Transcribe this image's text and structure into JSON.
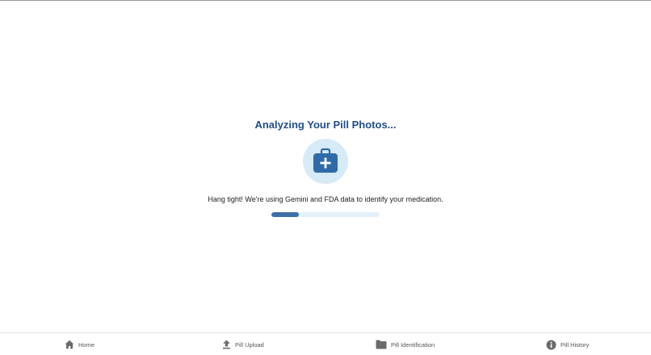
{
  "main": {
    "title": "Analyzing Your Pill Photos...",
    "icon": "medical-kit-icon",
    "message": "Hang tight! We're using Gemini and FDA data to identify your medication.",
    "progress": 0.25
  },
  "nav": {
    "items": [
      {
        "label": "Home",
        "icon": "home-icon"
      },
      {
        "label": "Pill Upload",
        "icon": "upload-icon"
      },
      {
        "label": "Pill Identification",
        "icon": "folder-icon"
      },
      {
        "label": "Pill History",
        "icon": "info-icon"
      }
    ]
  },
  "colors": {
    "title": "#1f4e8c",
    "accent": "#2f6ba8",
    "icon_bg": "#d6eaf8",
    "progress_track": "#e4f1fb",
    "progress_fill": "#3d6fa8",
    "nav_icon": "#6b6b6b"
  }
}
